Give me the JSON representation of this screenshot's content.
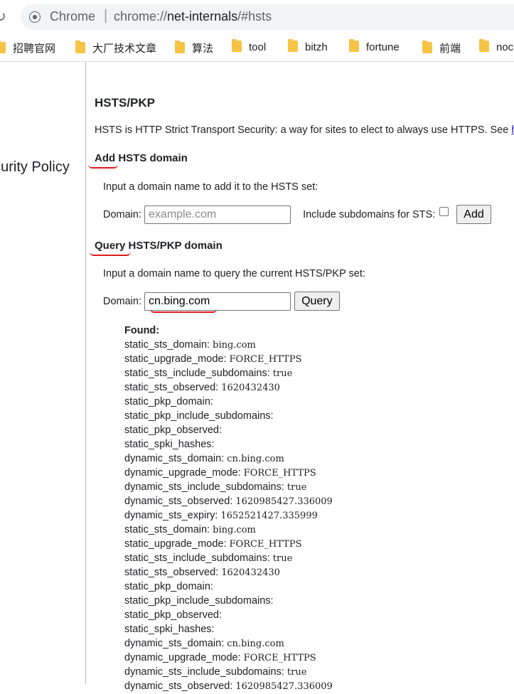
{
  "browser": {
    "omnibox_label": "Chrome",
    "url_scheme": "chrome://",
    "url_host": "net-internals",
    "url_path": "/#hsts"
  },
  "bookmarks": [
    "招聘官网",
    "大厂技术文章",
    "算法",
    "tool",
    "bitzh",
    "fortune",
    "前端",
    "noc"
  ],
  "sidebar": {
    "item_label": "ecurity Policy"
  },
  "page": {
    "title": "HSTS/PKP",
    "description": "HSTS is HTTP Strict Transport Security: a way for sites to elect to always use HTTPS. See ",
    "description_link": "ht"
  },
  "add_section": {
    "heading": "Add HSTS domain",
    "hint": "Input a domain name to add it to the HSTS set:",
    "domain_label": "Domain:",
    "domain_placeholder": "example.com",
    "subdomains_label": "Include subdomains for STS:",
    "button": "Add"
  },
  "query_section": {
    "heading": "Query HSTS/PKP domain",
    "hint": "Input a domain name to query the current HSTS/PKP set:",
    "domain_label": "Domain:",
    "domain_value": "cn.bing.com",
    "button": "Query"
  },
  "results": {
    "found_label": "Found:",
    "rows": [
      {
        "key": "static_sts_domain:",
        "value": "bing.com"
      },
      {
        "key": "static_upgrade_mode:",
        "value": "FORCE_HTTPS"
      },
      {
        "key": "static_sts_include_subdomains:",
        "value": "true"
      },
      {
        "key": "static_sts_observed:",
        "value": "1620432430"
      },
      {
        "key": "static_pkp_domain:",
        "value": ""
      },
      {
        "key": "static_pkp_include_subdomains:",
        "value": ""
      },
      {
        "key": "static_pkp_observed:",
        "value": ""
      },
      {
        "key": "static_spki_hashes:",
        "value": ""
      },
      {
        "key": "dynamic_sts_domain:",
        "value": "cn.bing.com"
      },
      {
        "key": "dynamic_upgrade_mode:",
        "value": "FORCE_HTTPS"
      },
      {
        "key": "dynamic_sts_include_subdomains:",
        "value": "true"
      },
      {
        "key": "dynamic_sts_observed:",
        "value": "1620985427.336009"
      },
      {
        "key": "dynamic_sts_expiry:",
        "value": "1652521427.335999"
      },
      {
        "key": "static_sts_domain:",
        "value": "bing.com"
      },
      {
        "key": "static_upgrade_mode:",
        "value": "FORCE_HTTPS"
      },
      {
        "key": "static_sts_include_subdomains:",
        "value": "true"
      },
      {
        "key": "static_sts_observed:",
        "value": "1620432430"
      },
      {
        "key": "static_pkp_domain:",
        "value": ""
      },
      {
        "key": "static_pkp_include_subdomains:",
        "value": ""
      },
      {
        "key": "static_pkp_observed:",
        "value": ""
      },
      {
        "key": "static_spki_hashes:",
        "value": ""
      },
      {
        "key": "dynamic_sts_domain:",
        "value": "cn.bing.com"
      },
      {
        "key": "dynamic_upgrade_mode:",
        "value": "FORCE_HTTPS"
      },
      {
        "key": "dynamic_sts_include_subdomains:",
        "value": "true"
      },
      {
        "key": "dynamic_sts_observed:",
        "value": "1620985427.336009"
      }
    ]
  },
  "annotation_color": "#e01b1b"
}
